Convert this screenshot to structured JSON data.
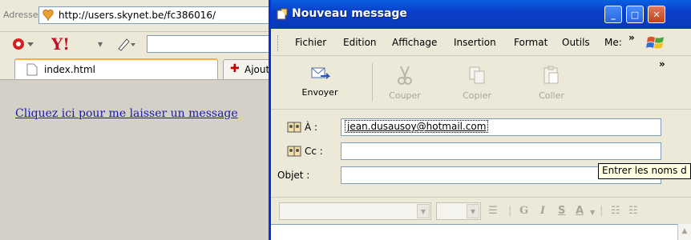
{
  "browser": {
    "address_label": "Adresse",
    "url": "http://users.skynet.be/fc386016/",
    "tab_active": "index.html",
    "tab_add": "Ajout",
    "page_link": "Cliquez ici pour me laisser un message"
  },
  "window": {
    "title": "Nouveau message",
    "menu": [
      "Fichier",
      "Edition",
      "Affichage",
      "Insertion",
      "Format",
      "Outils",
      "Me:"
    ],
    "menu_more": "»",
    "toolbar_more": "»",
    "toolbar": [
      {
        "label": "Envoyer",
        "icon": "send-icon",
        "enabled": true
      },
      {
        "label": "Couper",
        "icon": "cut-icon",
        "enabled": false
      },
      {
        "label": "Copier",
        "icon": "copy-icon",
        "enabled": false
      },
      {
        "label": "Coller",
        "icon": "paste-icon",
        "enabled": false
      }
    ],
    "fields": {
      "to_label": "À :",
      "to_value": "jean.dusausoy@hotmail.com",
      "cc_label": "Cc :",
      "cc_value": "",
      "subject_label": "Objet :",
      "subject_value": ""
    },
    "tooltip": "Entrer les noms d",
    "format": {
      "bold": "G",
      "italic": "I",
      "underline": "S",
      "color": "A"
    }
  },
  "colors": {
    "titlebar": "#0a3fc8",
    "link": "#1a1aa6",
    "tooltip_bg": "#ffffe1"
  }
}
